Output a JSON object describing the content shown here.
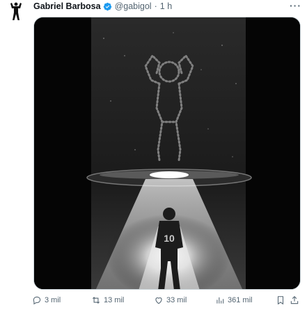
{
  "tweet": {
    "author_name": "Gabriel Barbosa",
    "handle": "@gabigol",
    "separator": "·",
    "time": "1 h",
    "more_label": "···"
  },
  "actions": {
    "replies": "3 mil",
    "retweets": "13 mil",
    "likes": "33 mil",
    "views": "361 mil"
  },
  "colors": {
    "verified_badge": "#1d9bf0",
    "secondary_text": "#536471"
  },
  "icons": [
    "avatar-silhouette",
    "verified-icon",
    "more-icon",
    "reply-icon",
    "retweet-icon",
    "like-icon",
    "views-icon",
    "bookmark-icon",
    "share-icon"
  ]
}
